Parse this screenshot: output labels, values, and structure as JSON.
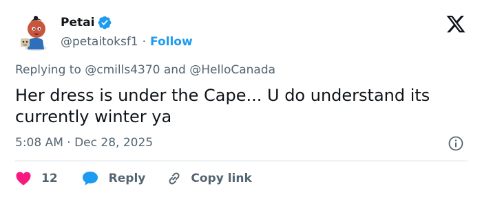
{
  "author": {
    "display_name": "Petai",
    "handle": "@petaitoksf1",
    "separator": "·",
    "follow_label": "Follow"
  },
  "reply_context": {
    "prefix": "Replying to",
    "mention_1": "@cmills4370",
    "conjunction": "and",
    "mention_2": "@HelloCanada"
  },
  "tweet": {
    "text": "Her dress is under the Cape... U do understand its currently winter ya",
    "timestamp": "5:08 AM · Dec 28, 2025"
  },
  "actions": {
    "like_count": "12",
    "reply_label": "Reply",
    "copy_label": "Copy link"
  },
  "colors": {
    "accent": "#1d9bf0",
    "like": "#f91880",
    "text": "#0f1419",
    "secondary": "#536471",
    "divider": "#cfd9de"
  },
  "icons": {
    "verified": "verified-badge-icon",
    "x_logo": "x-logo-icon",
    "info": "info-icon",
    "like": "heart-icon",
    "reply": "speech-bubble-icon",
    "copy": "link-icon"
  }
}
